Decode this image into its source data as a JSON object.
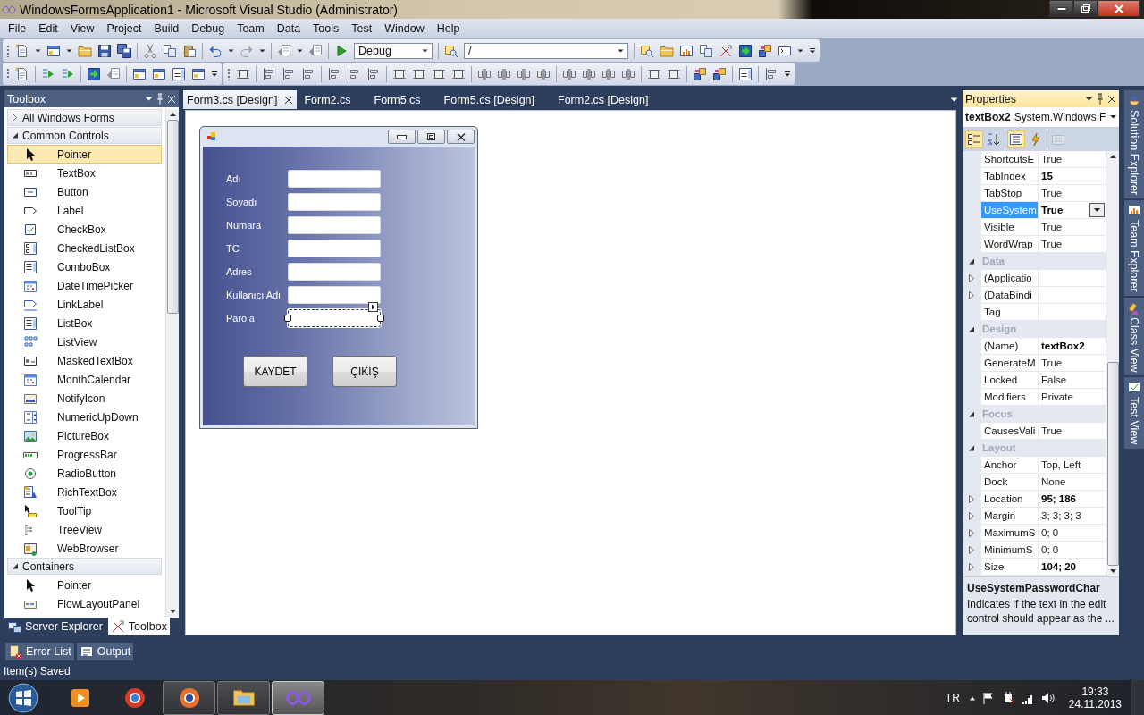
{
  "window": {
    "title": "WindowsFormsApplication1 - Microsoft Visual Studio (Administrator)"
  },
  "menu": [
    "File",
    "Edit",
    "View",
    "Project",
    "Build",
    "Debug",
    "Team",
    "Data",
    "Tools",
    "Test",
    "Window",
    "Help"
  ],
  "toolbar": {
    "configuration": "Debug",
    "platform": "/"
  },
  "toolbox": {
    "title": "Toolbox",
    "groups": [
      {
        "label": "All Windows Forms",
        "expanded": false
      },
      {
        "label": "Common Controls",
        "expanded": true,
        "items": [
          {
            "label": "Pointer",
            "selected": true
          },
          {
            "label": "TextBox",
            "selected": false
          },
          {
            "label": "Button",
            "selected": false
          },
          {
            "label": "Label",
            "selected": false
          },
          {
            "label": "CheckBox",
            "selected": false
          },
          {
            "label": "CheckedListBox",
            "selected": false
          },
          {
            "label": "ComboBox",
            "selected": false
          },
          {
            "label": "DateTimePicker",
            "selected": false
          },
          {
            "label": "LinkLabel",
            "selected": false
          },
          {
            "label": "ListBox",
            "selected": false
          },
          {
            "label": "ListView",
            "selected": false
          },
          {
            "label": "MaskedTextBox",
            "selected": false
          },
          {
            "label": "MonthCalendar",
            "selected": false
          },
          {
            "label": "NotifyIcon",
            "selected": false
          },
          {
            "label": "NumericUpDown",
            "selected": false
          },
          {
            "label": "PictureBox",
            "selected": false
          },
          {
            "label": "ProgressBar",
            "selected": false
          },
          {
            "label": "RadioButton",
            "selected": false
          },
          {
            "label": "RichTextBox",
            "selected": false
          },
          {
            "label": "ToolTip",
            "selected": false
          },
          {
            "label": "TreeView",
            "selected": false
          },
          {
            "label": "WebBrowser",
            "selected": false
          }
        ]
      },
      {
        "label": "Containers",
        "expanded": true,
        "items": [
          {
            "label": "Pointer",
            "selected": false
          },
          {
            "label": "FlowLayoutPanel",
            "selected": false
          }
        ]
      }
    ],
    "tabs": [
      {
        "label": "Server Explorer",
        "selected": false
      },
      {
        "label": "Toolbox",
        "selected": true
      }
    ]
  },
  "documents": {
    "tabs": [
      {
        "label": "Form3.cs [Design]",
        "selected": true
      },
      {
        "label": "Form2.cs",
        "selected": false
      },
      {
        "label": "Form5.cs",
        "selected": false
      },
      {
        "label": "Form5.cs [Design]",
        "selected": false
      },
      {
        "label": "Form2.cs [Design]",
        "selected": false
      }
    ]
  },
  "form": {
    "fields": [
      {
        "label": "Adı",
        "selected": false
      },
      {
        "label": "Soyadı",
        "selected": false
      },
      {
        "label": "Numara",
        "selected": false
      },
      {
        "label": "TC",
        "selected": false
      },
      {
        "label": "Adres",
        "selected": false
      },
      {
        "label": "Kullanıcı Adı",
        "selected": false
      },
      {
        "label": "Parola",
        "selected": true
      }
    ],
    "buttons": [
      "KAYDET",
      "ÇIKIŞ"
    ]
  },
  "properties": {
    "title": "Properties",
    "object": {
      "name": "textBox2",
      "type": "System.Windows.F"
    },
    "view_buttons": [
      {
        "selected": true,
        "disabled": false
      },
      {
        "selected": false,
        "disabled": false
      },
      {
        "selected": true,
        "disabled": false
      },
      {
        "selected": false,
        "disabled": false
      },
      {
        "selected": false,
        "disabled": true
      }
    ],
    "rows": [
      {
        "kind": "property",
        "name": "ShortcutsE",
        "value": "True",
        "bold": false,
        "expandable": false,
        "selected": false
      },
      {
        "kind": "property",
        "name": "TabIndex",
        "value": "15",
        "bold": true,
        "expandable": false,
        "selected": false
      },
      {
        "kind": "property",
        "name": "TabStop",
        "value": "True",
        "bold": false,
        "expandable": false,
        "selected": false
      },
      {
        "kind": "property",
        "name": "UseSystem",
        "value": "True",
        "bold": true,
        "expandable": false,
        "selected": true
      },
      {
        "kind": "property",
        "name": "Visible",
        "value": "True",
        "bold": false,
        "expandable": false,
        "selected": false
      },
      {
        "kind": "property",
        "name": "WordWrap",
        "value": "True",
        "bold": false,
        "expandable": false,
        "selected": false
      },
      {
        "kind": "category",
        "name": "Data",
        "expanded": true
      },
      {
        "kind": "property",
        "name": "(Applicatio",
        "expandable": true,
        "selected": false
      },
      {
        "kind": "property",
        "name": "(DataBindi",
        "expandable": true,
        "selected": false
      },
      {
        "kind": "property",
        "name": "Tag",
        "expandable": false,
        "selected": false
      },
      {
        "kind": "category",
        "name": "Design",
        "expanded": true
      },
      {
        "kind": "property",
        "name": "(Name)",
        "value": "textBox2",
        "bold": true,
        "expandable": false,
        "selected": false
      },
      {
        "kind": "property",
        "name": "GenerateM",
        "value": "True",
        "bold": false,
        "expandable": false,
        "selected": false
      },
      {
        "kind": "property",
        "name": "Locked",
        "value": "False",
        "bold": false,
        "expandable": false,
        "selected": false
      },
      {
        "kind": "property",
        "name": "Modifiers",
        "value": "Private",
        "bold": false,
        "expandable": false,
        "selected": false
      },
      {
        "kind": "category",
        "name": "Focus",
        "expanded": true
      },
      {
        "kind": "property",
        "name": "CausesVali",
        "value": "True",
        "bold": false,
        "expandable": false,
        "selected": false
      },
      {
        "kind": "category",
        "name": "Layout",
        "expanded": true
      },
      {
        "kind": "property",
        "name": "Anchor",
        "value": "Top, Left",
        "bold": false,
        "expandable": false,
        "selected": false
      },
      {
        "kind": "property",
        "name": "Dock",
        "value": "None",
        "bold": false,
        "expandable": false,
        "selected": false
      },
      {
        "kind": "property",
        "name": "Location",
        "value": "95; 186",
        "bold": true,
        "expandable": true,
        "selected": false
      },
      {
        "kind": "property",
        "name": "Margin",
        "value": "3; 3; 3; 3",
        "bold": false,
        "expandable": true,
        "selected": false
      },
      {
        "kind": "property",
        "name": "MaximumS",
        "value": "0; 0",
        "bold": false,
        "expandable": true,
        "selected": false
      },
      {
        "kind": "property",
        "name": "MinimumS",
        "value": "0; 0",
        "bold": false,
        "expandable": true,
        "selected": false
      },
      {
        "kind": "property",
        "name": "Size",
        "value": "104; 20",
        "bold": true,
        "expandable": true,
        "selected": false
      }
    ],
    "description": {
      "title": "UseSystemPasswordChar",
      "text": "Indicates if the text in the edit control should appear as the ..."
    }
  },
  "side_tabs": [
    "Solution Explorer",
    "Team Explorer",
    "Class View",
    "Test View"
  ],
  "bottom_tabs": [
    "Error List",
    "Output"
  ],
  "status_bar": "Item(s) Saved",
  "taskbar": {
    "apps": [
      {
        "running": false,
        "selected": false
      },
      {
        "running": false,
        "selected": false
      },
      {
        "running": true,
        "selected": false
      },
      {
        "running": true,
        "selected": false
      },
      {
        "running": true,
        "selected": true
      }
    ],
    "language": "TR",
    "time": "19:33",
    "date": "24.11.2013"
  }
}
